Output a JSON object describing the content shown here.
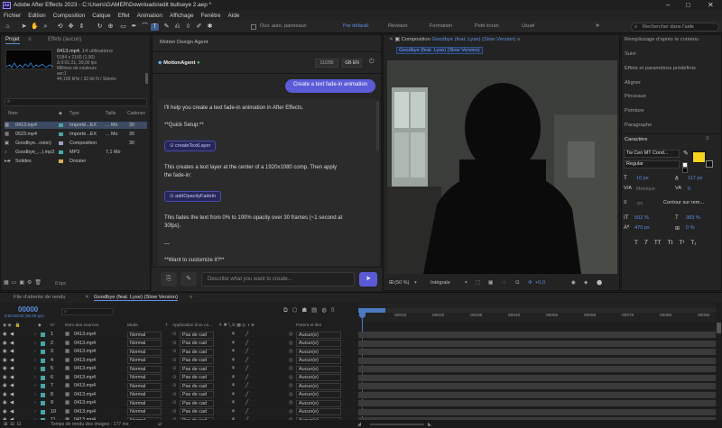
{
  "window": {
    "title": "Adobe After Effects 2023 - C:\\Users\\GAMER\\Downloads\\edit bullseye 2.aep *",
    "logo": "Ae",
    "minimize": "–",
    "maximize": "□",
    "close": "✕"
  },
  "menu": [
    "Fichier",
    "Edition",
    "Composition",
    "Calque",
    "Effet",
    "Animation",
    "Affichage",
    "Fenêtre",
    "Aide"
  ],
  "toolbar": {
    "auto_panels_label": "Ouv. auto. panneaux",
    "workspaces": [
      "Par défaut",
      "Révision",
      "Formation",
      "Petit écran",
      "Usuel"
    ],
    "active_workspace": "Par défaut",
    "search_placeholder": "Rechercher dans l'aide"
  },
  "project": {
    "tab_label": "Projet",
    "effects_tab": "Effets (aucun)",
    "selected_file": "0413.mp4",
    "usage": ", 14 utilisations",
    "details": [
      "5184 x 2160 (1,00)",
      "Δ 0:01:21, 30,00 ips",
      "Millions de couleurs",
      "avc1",
      "44,100 kHz / 32 bit N / Stéréo"
    ],
    "search_placeholder": "",
    "columns": [
      "Nom",
      "Type",
      "Taille",
      "Cadence"
    ],
    "items": [
      {
        "name": "0413.mp4",
        "type": "Importé...EX",
        "size": "... Mo",
        "rate": "30",
        "color": "#4aa3a3",
        "icon": "film-icon"
      },
      {
        "name": "0523.mp4",
        "type": "Importé...EX",
        "size": "... Mo",
        "rate": "30",
        "color": "#4aa3a3",
        "icon": "film-icon"
      },
      {
        "name": "Goodbye...rsion)",
        "type": "Composition",
        "size": "",
        "rate": "30",
        "color": "#a0a0c8",
        "icon": "composition-icon"
      },
      {
        "name": "Goodbye_...).mp3",
        "type": "MP3",
        "size": "7,1 Mo",
        "rate": "",
        "color": "#3fb0b0",
        "icon": "audio-file-icon"
      },
      {
        "name": "Solides",
        "type": "Dossier",
        "size": "",
        "rate": "",
        "color": "#d4b44a",
        "icon": "folder-icon"
      }
    ],
    "bpc": "8 bpc"
  },
  "agent": {
    "panel_title": "Motion Design Agent",
    "name": "MotionAgent",
    "token_count": "11/200",
    "lang": "EN",
    "lang_prefix": "GB",
    "user_message": "Create a text fade-in animation",
    "reply_paragraphs": [
      "I'll help you create a text fade-in animation in After Effects.",
      "**Quick Setup:**",
      "This creates a text layer at the center of a 1920x1080 comp. Then apply the fade-in:",
      "This fades the text from 0% to 100% opacity over 30 frames (~1 second at 30fps).",
      "---",
      "**Want to customize it?**"
    ],
    "functions": [
      "createTextLayer",
      "addOpacityFadeIn"
    ],
    "input_placeholder": "Describe what you want to create..."
  },
  "composition": {
    "tab_prefix": "Composition",
    "comp_name": "Goodbye (feat. Lyse) (Slow Version)",
    "sub_tab": "Goodbye (feat. Lyse) (Slow Version)",
    "zoom": "(50 %)",
    "resolution": "Intégrale",
    "exposure": "+0,0"
  },
  "right_panels": {
    "items": [
      "Remplissage d'après le contenu",
      "Suivi",
      "Effets et paramètres prédéfinis",
      "Aligner",
      "Pinceaux",
      "Peinture",
      "Paragraphe"
    ],
    "character_title": "Caractère",
    "font": "Tw Cen MT Cond...",
    "style": "Regular",
    "size": "10 px",
    "leading": "117 px",
    "kerning": "Métrique",
    "tracking": "0",
    "stroke_width": "- px",
    "stroke_type": "Contour sur rem...",
    "vscale": "502 %",
    "hscale": "383 %",
    "baseline": "470 px",
    "tsume": "0 %",
    "fill_color": "#f7d21f",
    "type_buttons": [
      "T",
      "T",
      "TT",
      "Tt",
      "T¹",
      "T₁"
    ]
  },
  "timeline": {
    "render_queue_tab": "File d'attente de rendu",
    "comp_tab": "Goodbye (feat. Lyse) (Slow Version)",
    "timecode": "00000",
    "timecode_sub": "0:00:00:00 (30.00 ips)",
    "columns": [
      "N°",
      "Nom des sources",
      "Mode",
      "T",
      "Application d'un ca...",
      "Parent et lien"
    ],
    "ruler": [
      "00010",
      "00020",
      "00030",
      "00040",
      "00050",
      "00060",
      "00070",
      "00080",
      "00090"
    ],
    "layers": [
      {
        "num": "1",
        "name": "0413.mp4",
        "mode": "Normal",
        "track": "Pas de cad",
        "parent": "Aucun(e)"
      },
      {
        "num": "2",
        "name": "0413.mp4",
        "mode": "Normal",
        "track": "Pas de cad",
        "parent": "Aucun(e)"
      },
      {
        "num": "3",
        "name": "0413.mp4",
        "mode": "Normal",
        "track": "Pas de cad",
        "parent": "Aucun(e)"
      },
      {
        "num": "4",
        "name": "0413.mp4",
        "mode": "Normal",
        "track": "Pas de cad",
        "parent": "Aucun(e)"
      },
      {
        "num": "5",
        "name": "0413.mp4",
        "mode": "Normal",
        "track": "Pas de cad",
        "parent": "Aucun(e)"
      },
      {
        "num": "6",
        "name": "0413.mp4",
        "mode": "Normal",
        "track": "Pas de cad",
        "parent": "Aucun(e)"
      },
      {
        "num": "7",
        "name": "0413.mp4",
        "mode": "Normal",
        "track": "Pas de cad",
        "parent": "Aucun(e)"
      },
      {
        "num": "8",
        "name": "0413.mp4",
        "mode": "Normal",
        "track": "Pas de cad",
        "parent": "Aucun(e)"
      },
      {
        "num": "9",
        "name": "0413.mp4",
        "mode": "Normal",
        "track": "Pas de cad",
        "parent": "Aucun(e)"
      },
      {
        "num": "10",
        "name": "0413.mp4",
        "mode": "Normal",
        "track": "Pas de cad",
        "parent": "Aucun(e)"
      },
      {
        "num": "11",
        "name": "0413.mp4",
        "mode": "Normal",
        "track": "Pas de cad",
        "parent": "Aucun(e)"
      }
    ],
    "footer": "Temps de rendu des images : 177 ms"
  }
}
